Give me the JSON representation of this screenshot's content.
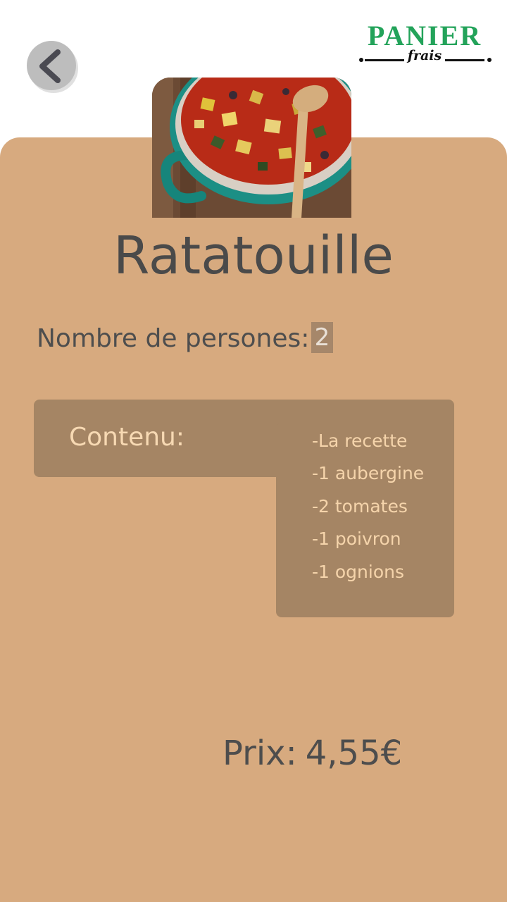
{
  "header": {
    "back_icon": "chevron-left-icon",
    "logo": {
      "word": "PANIER",
      "sub": "frais",
      "color": "#23a35a"
    }
  },
  "recipe": {
    "title": "Ratatouille",
    "image_alt": "Ratatouille in a green cast-iron pot with a wooden spoon"
  },
  "persons": {
    "label": "Nombre de persones:",
    "value": "2"
  },
  "contents": {
    "label": "Contenu:",
    "items": [
      "-La recette",
      "-1 aubergine",
      "-2 tomates",
      "-1 poivron",
      "-1 ognions"
    ]
  },
  "price": {
    "label": "Prix:",
    "value": "4,55€"
  },
  "colors": {
    "card_bg": "#d7aa7f",
    "box_bg": "#a58564",
    "box_text": "#f5d4ab",
    "text_dark": "#4a4a4a"
  }
}
